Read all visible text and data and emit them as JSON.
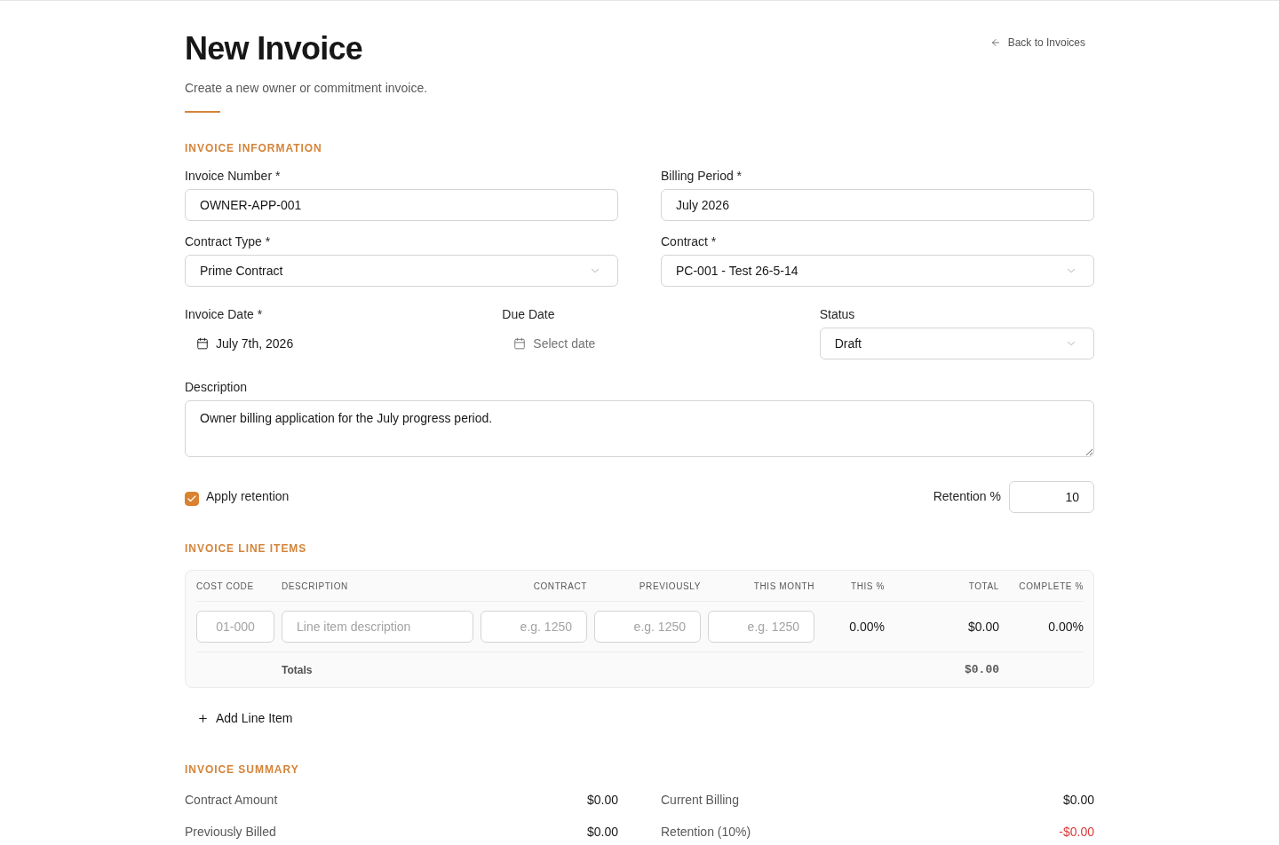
{
  "header": {
    "title": "New Invoice",
    "subtitle": "Create a new owner or commitment invoice.",
    "back_link": "Back to Invoices"
  },
  "invoice_information": {
    "heading": "INVOICE INFORMATION",
    "invoice_number": {
      "label": "Invoice Number *",
      "value": "OWNER-APP-001"
    },
    "billing_period": {
      "label": "Billing Period *",
      "value": "July 2026"
    },
    "contract_type": {
      "label": "Contract Type *",
      "value": "Prime Contract"
    },
    "contract": {
      "label": "Contract *",
      "value": "PC-001 - Test 26-5-14"
    },
    "invoice_date": {
      "label": "Invoice Date *",
      "value": "July 7th, 2026"
    },
    "due_date": {
      "label": "Due Date",
      "placeholder": "Select date"
    },
    "status": {
      "label": "Status",
      "value": "Draft"
    },
    "description": {
      "label": "Description",
      "value": "Owner billing application for the July progress period."
    },
    "apply_retention": {
      "label": "Apply retention",
      "checked": true
    },
    "retention_percent": {
      "label": "Retention %",
      "value": "10"
    }
  },
  "line_items": {
    "heading": "INVOICE LINE ITEMS",
    "columns": [
      "COST CODE",
      "DESCRIPTION",
      "CONTRACT",
      "PREVIOUSLY",
      "THIS MONTH",
      "THIS %",
      "TOTAL",
      "COMPLETE %"
    ],
    "rows": [
      {
        "cost_code": {
          "placeholder": "01-000"
        },
        "description": {
          "placeholder": "Line item description"
        },
        "contract": {
          "placeholder": "e.g. 1250"
        },
        "previously": {
          "placeholder": "e.g. 1250"
        },
        "this_month": {
          "placeholder": "e.g. 1250"
        },
        "this_percent": "0.00%",
        "total": "$0.00",
        "complete_percent": "0.00%"
      }
    ],
    "totals": {
      "label": "Totals",
      "total": "$0.00"
    },
    "add_button": "Add Line Item"
  },
  "summary": {
    "heading": "INVOICE SUMMARY",
    "left": [
      {
        "label": "Contract Amount",
        "value": "$0.00",
        "kind": "amount"
      },
      {
        "label": "Previously Billed",
        "value": "$0.00",
        "kind": "amount"
      }
    ],
    "right": [
      {
        "label": "Current Billing",
        "value": "$0.00",
        "kind": "amount"
      },
      {
        "label": "Retention (10%)",
        "value": "-$0.00",
        "kind": "deduction"
      }
    ]
  }
}
